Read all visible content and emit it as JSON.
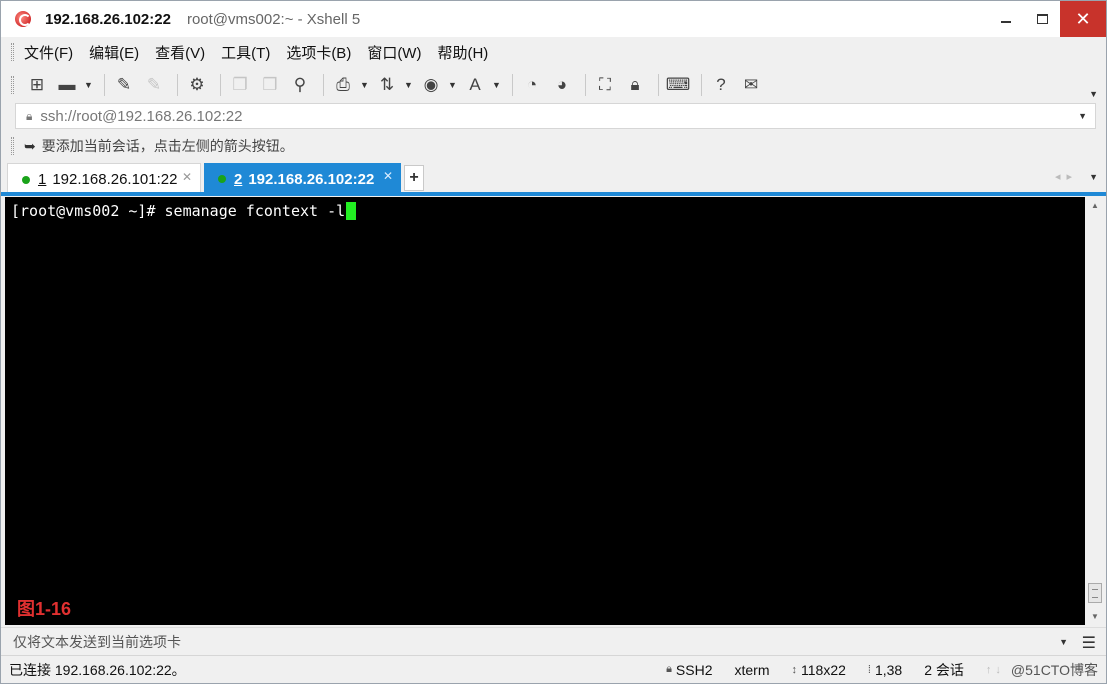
{
  "titlebar": {
    "app_icon": "xshell-logo-icon",
    "title_main": "192.168.26.102:22",
    "title_sub": "root@vms002:~ - Xshell 5",
    "close_glyph": "✕"
  },
  "menubar": {
    "items": [
      "文件(F)",
      "编辑(E)",
      "查看(V)",
      "工具(T)",
      "选项卡(B)",
      "窗口(W)",
      "帮助(H)"
    ]
  },
  "toolbar": {
    "icons": [
      "new-session-icon",
      "open-folder-icon",
      "connect-icon",
      "disconnect-icon",
      "properties-icon",
      "copy-icon",
      "paste-icon",
      "find-icon",
      "print-icon",
      "transfer-icon",
      "globe-icon",
      "font-icon",
      "xftp-icon",
      "xmanager-icon",
      "fullscreen-icon",
      "lock-icon",
      "keyboard-icon",
      "help-icon",
      "chat-icon"
    ]
  },
  "address": {
    "text": "ssh://root@192.168.26.102:22"
  },
  "hint": {
    "text": "要添加当前会话，点击左侧的箭头按钮。"
  },
  "tabs": [
    {
      "number": "1",
      "label": "192.168.26.101:22",
      "active": false,
      "status_color": "#1aa31a"
    },
    {
      "number": "2",
      "label": "192.168.26.102:22",
      "active": true,
      "status_color": "#1aa31a"
    }
  ],
  "tab_add": "+",
  "terminal": {
    "prompt": "[root@vms002 ~]# semanage fcontext -l",
    "cursor_color": "#22ee22",
    "figure_label": "图1-16",
    "figure_label_color": "#e03030"
  },
  "compose": {
    "placeholder": "仅将文本发送到当前选项卡"
  },
  "statusbar": {
    "connected": "已连接 192.168.26.102:22。",
    "protocol": "SSH2",
    "term": "xterm",
    "size": "118x22",
    "position": "1,38",
    "sessions": "2 会话",
    "watermark": "@51CTO博客"
  },
  "colors": {
    "accent": "#1f89d6",
    "close": "#c8332b"
  }
}
